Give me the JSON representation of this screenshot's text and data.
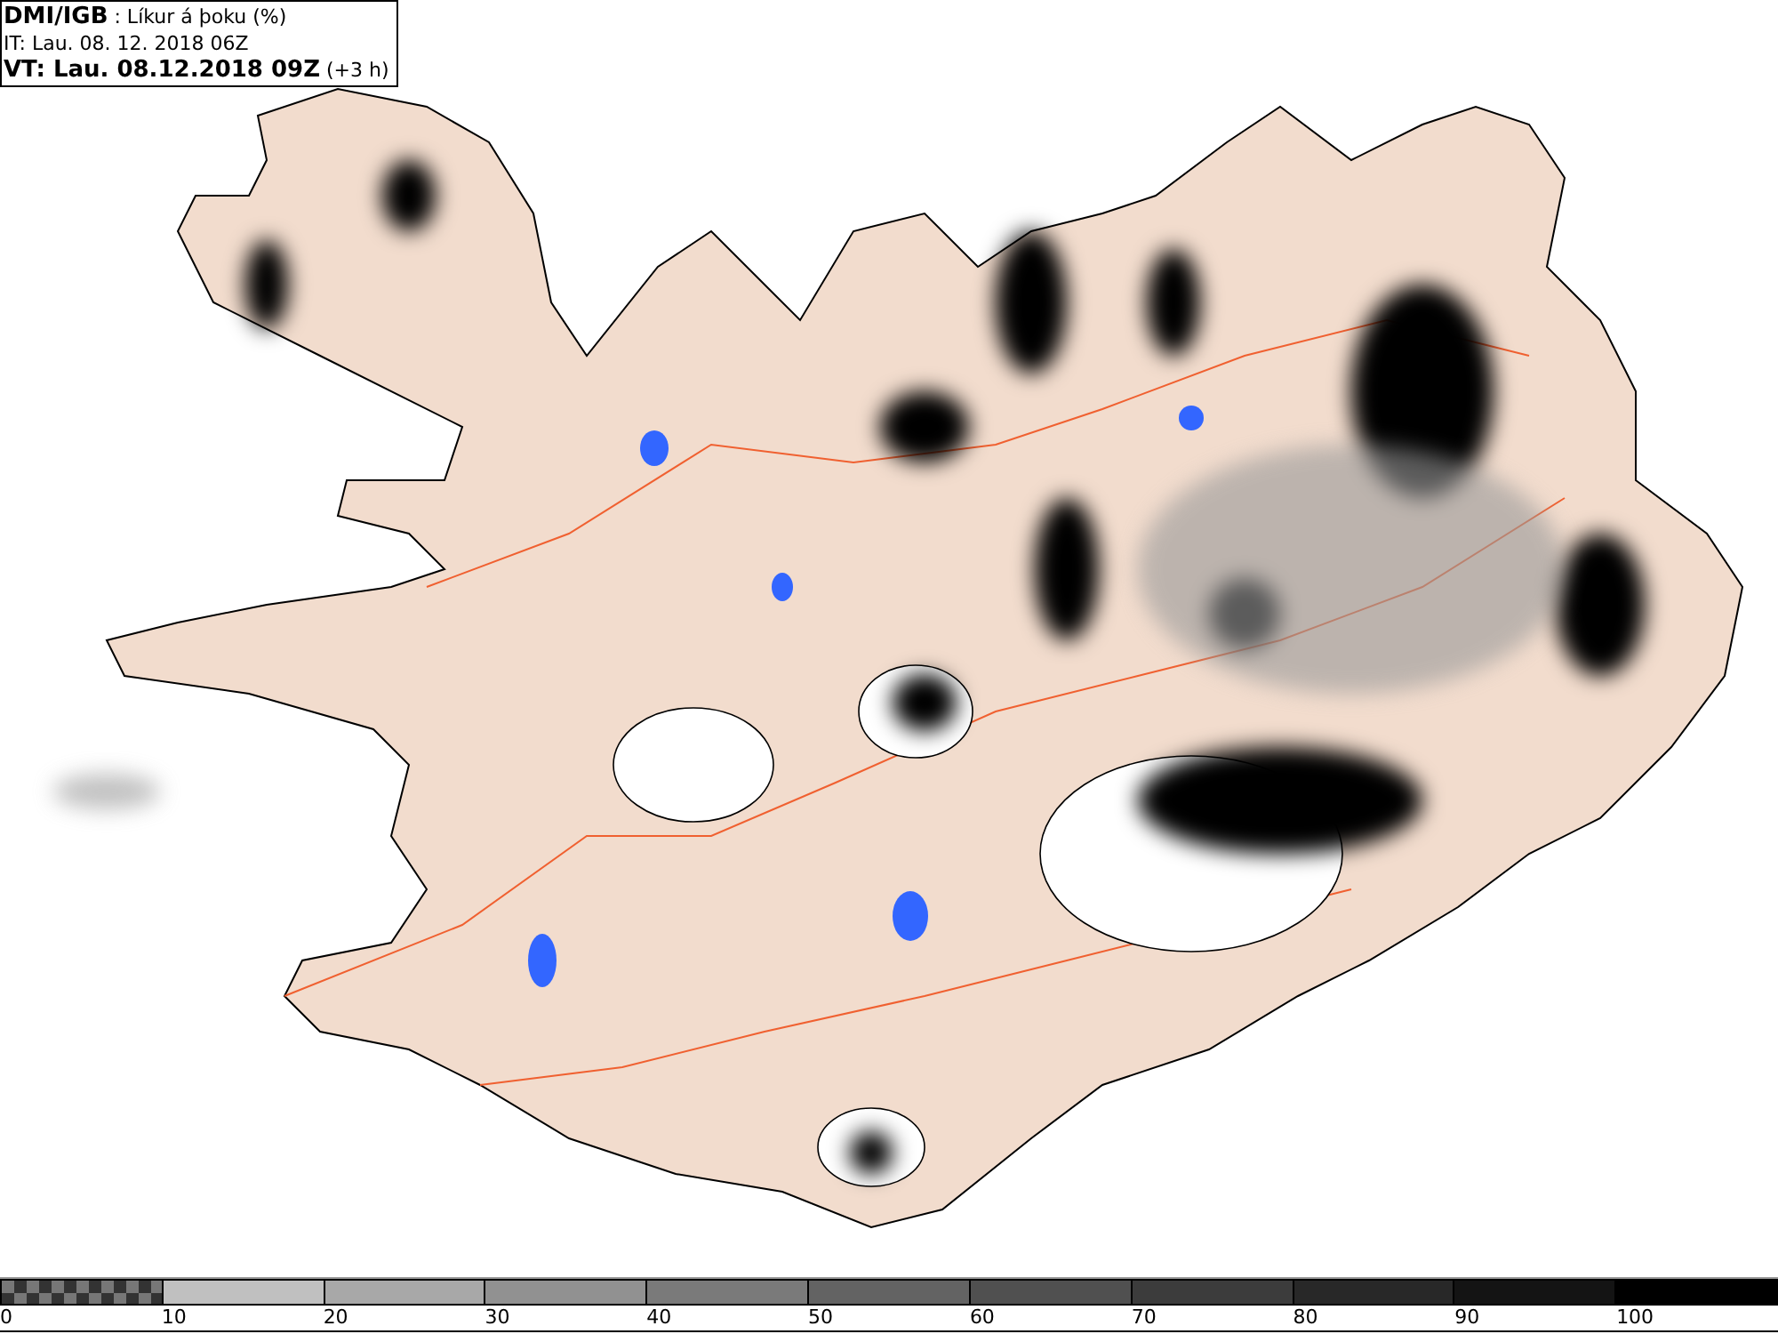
{
  "header": {
    "source": "DMI/IGB",
    "title": ": Líkur á þoku (%)",
    "init_time": "IT: Lau. 08. 12. 2018 06Z",
    "valid_time": "VT: Lau. 08.12.2018 09Z",
    "offset": "(+3 h)"
  },
  "legend": {
    "segments": [
      {
        "kind": "checker",
        "color": "#777777",
        "label": "0"
      },
      {
        "kind": "solid",
        "color": "#c0c0c0",
        "label": "10"
      },
      {
        "kind": "solid",
        "color": "#a8a8a8",
        "label": "20"
      },
      {
        "kind": "solid",
        "color": "#919191",
        "label": "30"
      },
      {
        "kind": "solid",
        "color": "#7a7a7a",
        "label": "40"
      },
      {
        "kind": "solid",
        "color": "#636363",
        "label": "50"
      },
      {
        "kind": "solid",
        "color": "#505050",
        "label": "60"
      },
      {
        "kind": "solid",
        "color": "#3c3c3c",
        "label": "70"
      },
      {
        "kind": "solid",
        "color": "#282828",
        "label": "80"
      },
      {
        "kind": "solid",
        "color": "#141414",
        "label": "90"
      },
      {
        "kind": "solid",
        "color": "#000000",
        "label": "100"
      }
    ]
  }
}
